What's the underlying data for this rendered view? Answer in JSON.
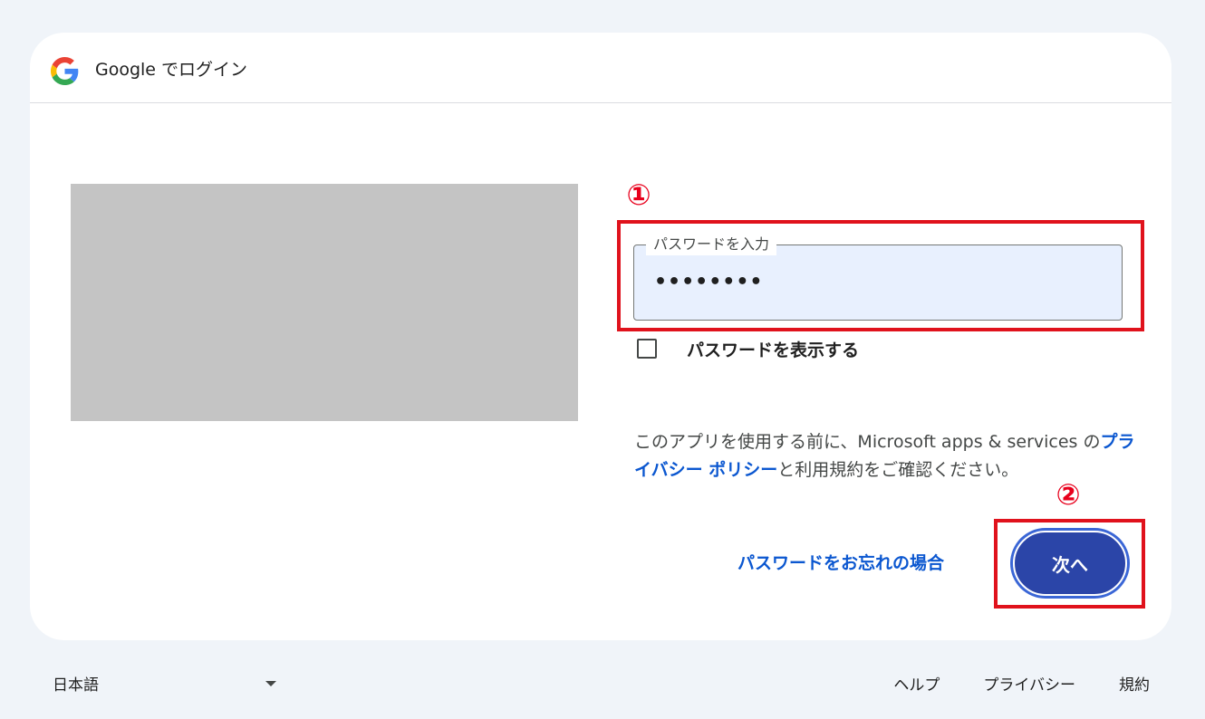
{
  "header": {
    "title": "Google でログイン",
    "logo_icon": "google-g-logo"
  },
  "annotations": {
    "step1": "①",
    "step2": "②",
    "highlight_color": "#e0121c"
  },
  "password_field": {
    "label": "パスワードを入力",
    "value": "••••••••"
  },
  "show_password": {
    "label": "パスワードを表示する",
    "checked": false
  },
  "terms": {
    "text_before": "このアプリを使用する前に、Microsoft apps & services の",
    "privacy_link": "プライバシー ポリシー",
    "text_after": "と利用規約をご確認ください。"
  },
  "actions": {
    "forgot_password": "パスワードをお忘れの場合",
    "next_button": "次へ"
  },
  "footer": {
    "language": "日本語",
    "links": [
      "ヘルプ",
      "プライバシー",
      "規約"
    ]
  },
  "colors": {
    "accent": "#0b57d0",
    "button_bg": "#2b45a8",
    "field_bg": "#e8f0fe",
    "page_bg": "#f0f4f9"
  }
}
